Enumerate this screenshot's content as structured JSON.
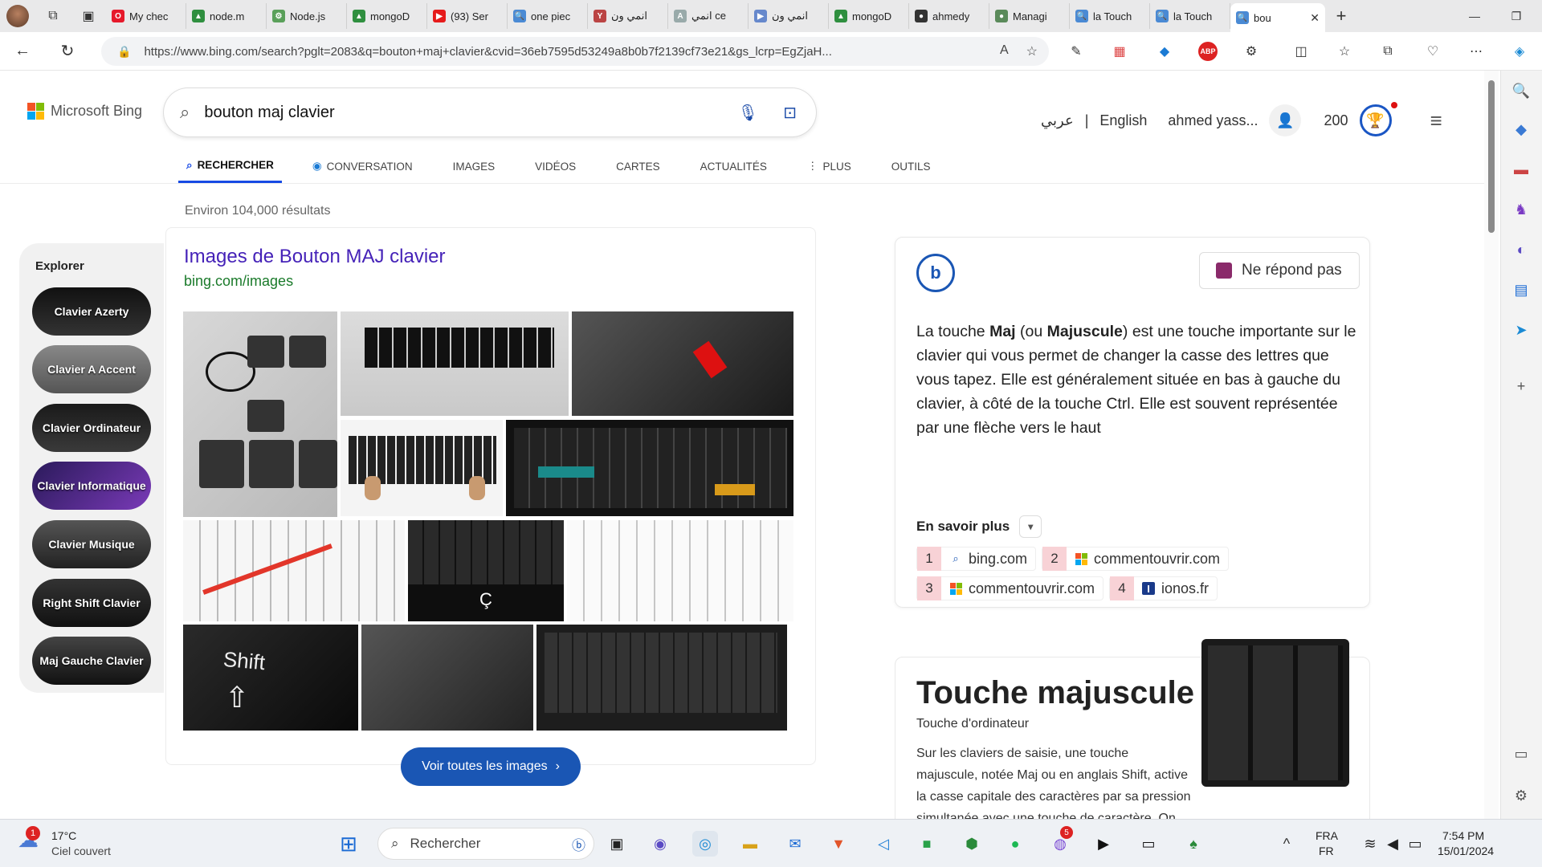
{
  "browser": {
    "tabs": [
      {
        "label": "My chec",
        "fav": "O",
        "color": "#e6192b"
      },
      {
        "label": "node.m",
        "fav": "▲",
        "color": "#2f8f3f"
      },
      {
        "label": "Node.js",
        "fav": "⚙",
        "color": "#5aa05a"
      },
      {
        "label": "mongoD",
        "fav": "▲",
        "color": "#2f8f3f"
      },
      {
        "label": "(93) Ser",
        "fav": "▶",
        "color": "#e61b1b"
      },
      {
        "label": "one piec",
        "fav": "🔍",
        "color": "#4a8ad4"
      },
      {
        "label": "انمي ون",
        "fav": "Y",
        "color": "#b44"
      },
      {
        "label": "انمي ce",
        "fav": "A",
        "color": "#9aa"
      },
      {
        "label": "انمي ون",
        "fav": "▶",
        "color": "#68c"
      },
      {
        "label": "mongoD",
        "fav": "▲",
        "color": "#2f8f3f"
      },
      {
        "label": "ahmedy",
        "fav": "●",
        "color": "#333"
      },
      {
        "label": "Managi",
        "fav": "●",
        "color": "#5a8a5a"
      },
      {
        "label": "la Touch",
        "fav": "🔍",
        "color": "#4a8ad4"
      },
      {
        "label": "la Touch",
        "fav": "🔍",
        "color": "#4a8ad4"
      },
      {
        "label": "bou",
        "fav": "🔍",
        "color": "#4a8ad4"
      }
    ],
    "url": "https://www.bing.com/search?pglt=2083&q=bouton+maj+clavier&cvid=36eb7595d53249a8b0b7f2139cf73e21&gs_lcrp=EgZjaH..."
  },
  "header": {
    "logo": "Microsoft Bing",
    "query": "bouton maj clavier",
    "lang_ar": "عربي",
    "separator": "|",
    "lang_en": "English",
    "user": "ahmed yass...",
    "points": "200"
  },
  "nav": {
    "items": [
      "RECHERCHER",
      "CONVERSATION",
      "IMAGES",
      "VIDÉOS",
      "CARTES",
      "ACTUALITÉS",
      "PLUS",
      "OUTILS"
    ]
  },
  "results_count": "Environ 104,000 résultats",
  "explore": {
    "title": "Explorer",
    "chips": [
      "Clavier Azerty",
      "Clavier A Accent",
      "Clavier Ordinateur",
      "Clavier Informatique",
      "Clavier Musique",
      "Right Shift Clavier",
      "Maj Gauche Clavier"
    ]
  },
  "images": {
    "title": "Images de Bouton MAJ clavier",
    "source": "bing.com/images",
    "see_all": "Voir toutes les images",
    "key_shift": "Shift",
    "key_c": "Ç"
  },
  "answer": {
    "no_answer": "Ne répond pas",
    "text_1": "La touche ",
    "bold_1": "Maj",
    "text_2": " (ou ",
    "bold_2": "Majuscule",
    "text_3": ") est une touche importante sur le clavier qui vous permet de changer la casse des lettres que vous tapez. Elle est généralement située en bas à gauche du clavier, à côté de la touche Ctrl. Elle est souvent représentée par une flèche vers le haut",
    "learn_more": "En savoir plus",
    "citations": [
      {
        "n": "1",
        "site": "bing.com"
      },
      {
        "n": "2",
        "site": "commentouvrir.com"
      },
      {
        "n": "3",
        "site": "commentouvrir.com"
      },
      {
        "n": "4",
        "site": "ionos.fr"
      }
    ]
  },
  "knowledge": {
    "title": "Touche majuscule",
    "subtitle": "Touche d'ordinateur",
    "desc": "Sur les claviers de saisie, une touche majuscule, notée Maj ou en anglais Shift, active la casse capitale des caractères par sa pression simultanée avec une touche de caractère. On peut trouver plusie"
  },
  "taskbar": {
    "weather_temp": "17°C",
    "weather_desc": "Ciel couvert",
    "weather_badge": "1",
    "search": "Rechercher",
    "messenger_badge": "5",
    "lang_1": "FRA",
    "lang_2": "FR",
    "time": "7:54 PM",
    "date": "15/01/2024"
  }
}
